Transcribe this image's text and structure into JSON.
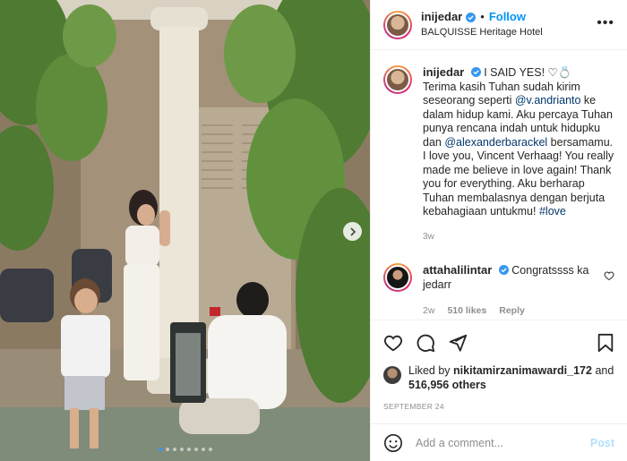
{
  "post": {
    "username": "inijedar",
    "follow_label": "Follow",
    "separator": "•",
    "location": "BALQUISSE Heritage Hotel",
    "more_icon": "more-horizontal-icon"
  },
  "caption": {
    "username": "inijedar",
    "headline": "I SAID YES! ♡💍",
    "text_1": "Terima kasih Tuhan sudah kirim seseorang seperti ",
    "mention_1": "@v.andrianto",
    "text_2": " ke dalam hidup kami. Aku percaya Tuhan punya rencana indah untuk hidupku dan ",
    "mention_2": "@alexanderbarackel",
    "text_3": " bersamamu.",
    "text_4": "I love you, Vincent Verhaag! You really made me believe in love again! Thank you for everything. Aku berharap Tuhan membalasnya dengan berjuta kebahagiaan untukmu! ",
    "hashtag": "#love",
    "time": "3w"
  },
  "comment": {
    "username": "attahalilintar",
    "text": "Congratssss ka jedarr",
    "time": "2w",
    "likes": "510 likes",
    "reply": "Reply"
  },
  "likes": {
    "prefix": "Liked by ",
    "user": "nikitamirzanimawardi_172",
    "and": " and",
    "others": "516,956 others"
  },
  "date": "SEPTEMBER 24",
  "add_comment": {
    "placeholder": "Add a comment...",
    "post_label": "Post"
  },
  "carousel": {
    "current": 1,
    "total": 8
  },
  "colors": {
    "accent_blue": "#0095f6",
    "verified_blue": "#3897f0",
    "mention": "#00376b",
    "muted": "#8e8e8e",
    "post_disabled": "#b2dffc"
  }
}
